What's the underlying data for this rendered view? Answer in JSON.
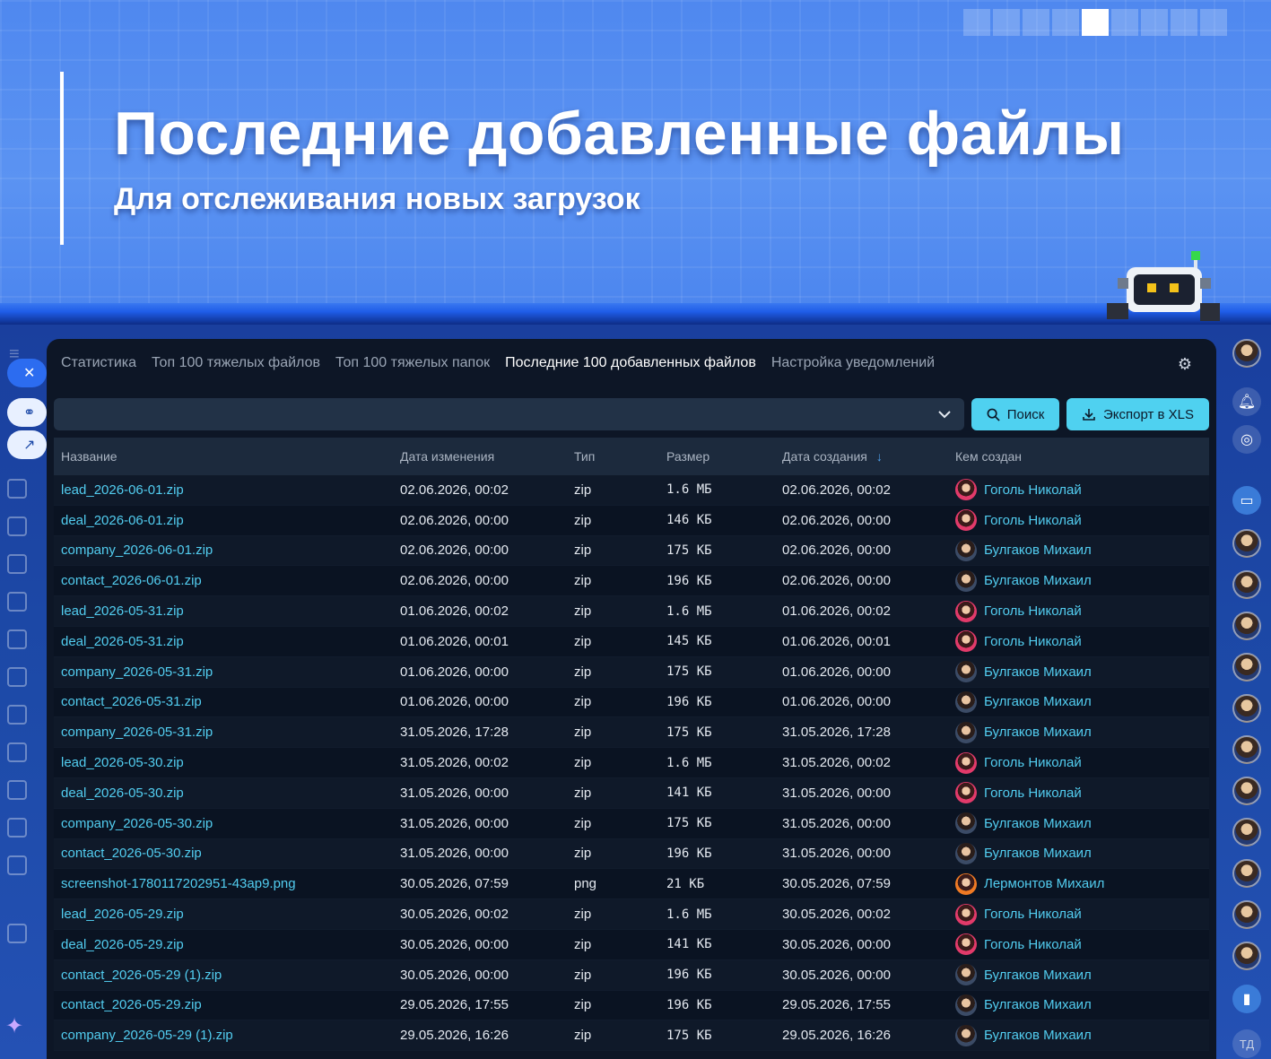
{
  "hero": {
    "title": "Последние добавленные файлы",
    "subtitle": "Для отслеживания новых загрузок"
  },
  "tabs": [
    {
      "label": "Статистика",
      "active": false
    },
    {
      "label": "Топ 100 тяжелых файлов",
      "active": false
    },
    {
      "label": "Топ 100 тяжелых папок",
      "active": false
    },
    {
      "label": "Последние 100 добавленных файлов",
      "active": true
    },
    {
      "label": "Настройка уведомлений",
      "active": false
    }
  ],
  "toolbar": {
    "search_label": "Поиск",
    "export_label": "Экспорт в XLS"
  },
  "table": {
    "headers": [
      "Название",
      "Дата изменения",
      "Тип",
      "Размер",
      "Дата создания",
      "Кем создан"
    ],
    "rows": [
      {
        "name": "lead_2026-06-01.zip",
        "modified": "02.06.2026, 00:02",
        "type": "zip",
        "size": "1.6 МБ",
        "created": "02.06.2026, 00:02",
        "author": "Гоголь Николай",
        "avatar": "gogol"
      },
      {
        "name": "deal_2026-06-01.zip",
        "modified": "02.06.2026, 00:00",
        "type": "zip",
        "size": "146 КБ",
        "created": "02.06.2026, 00:00",
        "author": "Гоголь Николай",
        "avatar": "gogol"
      },
      {
        "name": "company_2026-06-01.zip",
        "modified": "02.06.2026, 00:00",
        "type": "zip",
        "size": "175 КБ",
        "created": "02.06.2026, 00:00",
        "author": "Булгаков Михаил",
        "avatar": "bulg"
      },
      {
        "name": "contact_2026-06-01.zip",
        "modified": "02.06.2026, 00:00",
        "type": "zip",
        "size": "196 КБ",
        "created": "02.06.2026, 00:00",
        "author": "Булгаков Михаил",
        "avatar": "bulg"
      },
      {
        "name": "lead_2026-05-31.zip",
        "modified": "01.06.2026, 00:02",
        "type": "zip",
        "size": "1.6 МБ",
        "created": "01.06.2026, 00:02",
        "author": "Гоголь Николай",
        "avatar": "gogol"
      },
      {
        "name": "deal_2026-05-31.zip",
        "modified": "01.06.2026, 00:01",
        "type": "zip",
        "size": "145 КБ",
        "created": "01.06.2026, 00:01",
        "author": "Гоголь Николай",
        "avatar": "gogol"
      },
      {
        "name": "company_2026-05-31.zip",
        "modified": "01.06.2026, 00:00",
        "type": "zip",
        "size": "175 КБ",
        "created": "01.06.2026, 00:00",
        "author": "Булгаков Михаил",
        "avatar": "bulg"
      },
      {
        "name": "contact_2026-05-31.zip",
        "modified": "01.06.2026, 00:00",
        "type": "zip",
        "size": "196 КБ",
        "created": "01.06.2026, 00:00",
        "author": "Булгаков Михаил",
        "avatar": "bulg"
      },
      {
        "name": "company_2026-05-31.zip",
        "modified": "31.05.2026, 17:28",
        "type": "zip",
        "size": "175 КБ",
        "created": "31.05.2026, 17:28",
        "author": "Булгаков Михаил",
        "avatar": "bulg"
      },
      {
        "name": "lead_2026-05-30.zip",
        "modified": "31.05.2026, 00:02",
        "type": "zip",
        "size": "1.6 МБ",
        "created": "31.05.2026, 00:02",
        "author": "Гоголь Николай",
        "avatar": "gogol"
      },
      {
        "name": "deal_2026-05-30.zip",
        "modified": "31.05.2026, 00:00",
        "type": "zip",
        "size": "141 КБ",
        "created": "31.05.2026, 00:00",
        "author": "Гоголь Николай",
        "avatar": "gogol"
      },
      {
        "name": "company_2026-05-30.zip",
        "modified": "31.05.2026, 00:00",
        "type": "zip",
        "size": "175 КБ",
        "created": "31.05.2026, 00:00",
        "author": "Булгаков Михаил",
        "avatar": "bulg"
      },
      {
        "name": "contact_2026-05-30.zip",
        "modified": "31.05.2026, 00:00",
        "type": "zip",
        "size": "196 КБ",
        "created": "31.05.2026, 00:00",
        "author": "Булгаков Михаил",
        "avatar": "bulg"
      },
      {
        "name": "screenshot-1780117202951-43ap9.png",
        "modified": "30.05.2026, 07:59",
        "type": "png",
        "size": "21 КБ",
        "created": "30.05.2026, 07:59",
        "author": "Лермонтов Михаил",
        "avatar": "lerm"
      },
      {
        "name": "lead_2026-05-29.zip",
        "modified": "30.05.2026, 00:02",
        "type": "zip",
        "size": "1.6 МБ",
        "created": "30.05.2026, 00:02",
        "author": "Гоголь Николай",
        "avatar": "gogol"
      },
      {
        "name": "deal_2026-05-29.zip",
        "modified": "30.05.2026, 00:00",
        "type": "zip",
        "size": "141 КБ",
        "created": "30.05.2026, 00:00",
        "author": "Гоголь Николай",
        "avatar": "gogol"
      },
      {
        "name": "contact_2026-05-29 (1).zip",
        "modified": "30.05.2026, 00:00",
        "type": "zip",
        "size": "196 КБ",
        "created": "30.05.2026, 00:00",
        "author": "Булгаков Михаил",
        "avatar": "bulg"
      },
      {
        "name": "contact_2026-05-29.zip",
        "modified": "29.05.2026, 17:55",
        "type": "zip",
        "size": "196 КБ",
        "created": "29.05.2026, 17:55",
        "author": "Булгаков Михаил",
        "avatar": "bulg"
      },
      {
        "name": "company_2026-05-29 (1).zip",
        "modified": "29.05.2026, 16:26",
        "type": "zip",
        "size": "175 КБ",
        "created": "29.05.2026, 16:26",
        "author": "Булгаков Михаил",
        "avatar": "bulg"
      }
    ]
  },
  "right_rail": {
    "initials": "ТД"
  },
  "icons": {
    "settings": "gear-icon",
    "dropdown": "chevron-down-icon",
    "search": "search-icon",
    "export": "download-icon",
    "sort": "arrow-down-icon"
  },
  "colors": {
    "accent": "#4fd1f0",
    "link": "#52cdf0",
    "panel": "#0d1626",
    "hero": "#4d86ee"
  }
}
